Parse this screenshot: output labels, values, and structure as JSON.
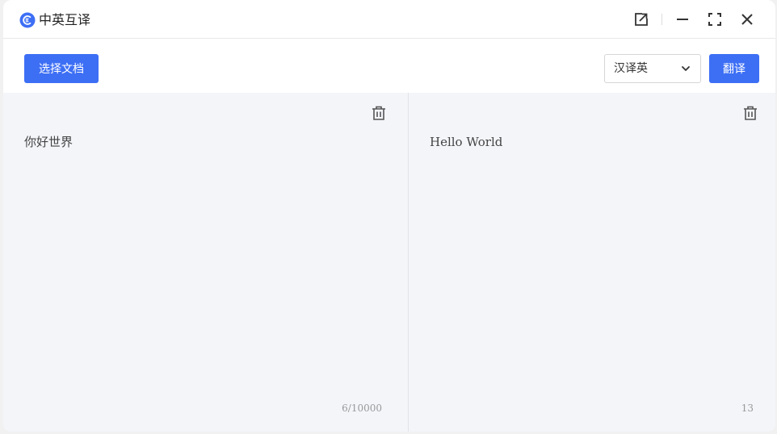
{
  "app": {
    "title": "中英互译",
    "logo_icon": "translate-logo-icon",
    "accent_color": "#3d6ff5"
  },
  "titlebar": {
    "icons": [
      "external-link-icon",
      "minimize-icon",
      "maximize-icon",
      "close-icon"
    ]
  },
  "toolbar": {
    "select_doc_label": "选择文档",
    "direction_select": {
      "value": "汉译英",
      "icon": "chevron-down-icon"
    },
    "translate_label": "翻译"
  },
  "source": {
    "text": "你好世界",
    "counter": "6/10000",
    "clear_icon": "trash-icon"
  },
  "target": {
    "text": "Hello World",
    "counter": "13",
    "clear_icon": "trash-icon"
  }
}
